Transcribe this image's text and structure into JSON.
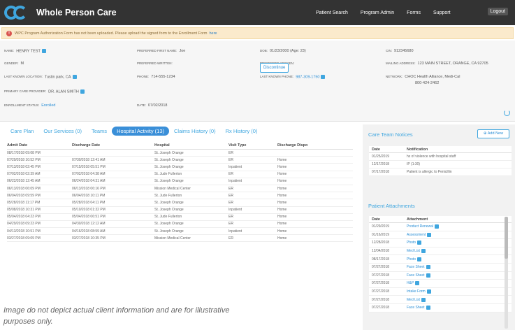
{
  "app": {
    "title": "Whole Person Care"
  },
  "topnav": {
    "items": [
      "Patient Search",
      "Program Admin",
      "Forms",
      "Support"
    ],
    "logout": "Logout"
  },
  "alert": {
    "text": "WPC Program Authorization Form has not been uploaded. Please upload the signed form to the Enrollment Form",
    "link": "here"
  },
  "profile": {
    "name": {
      "label": "NAME:",
      "value": "HENRY TEST"
    },
    "gender": {
      "label": "GENDER:",
      "value": "M"
    },
    "last_location": {
      "label": "LAST KNOWN LOCATION:",
      "value": "Tustin park, CA"
    },
    "pcp": {
      "label": "PRIMARY CARE PROVIDER:",
      "value": "DR. ALAN SMITH"
    },
    "enrollment": {
      "label": "ENROLLMENT STATUS:",
      "value": "Enrolled"
    },
    "preferred_first": {
      "label": "PREFERRED FIRST NAME:",
      "value": "Joe"
    },
    "preferred_written": {
      "label": "PREFERRED WRITTEN:",
      "value": ""
    },
    "phone": {
      "label": "PHONE:",
      "value": "714-555-1234"
    },
    "date": {
      "label": "DATE:",
      "value": "07/02/2018"
    },
    "dob": {
      "label": "DOB:",
      "value": "01/23/2000 (Age: 23)"
    },
    "preferred_spoken": {
      "label": "PREFERRED SPOKEN:",
      "value": ""
    },
    "last_phone": {
      "label": "LAST KNOWN PHONE:",
      "value": "987-309-1750"
    },
    "cin": {
      "label": "CIN:",
      "value": "912345680"
    },
    "mailing": {
      "label": "MAILING ADDRESS:",
      "value": "123 MAIN STREET, ORANGE, CA 92705"
    },
    "network": {
      "label": "NETWORK:",
      "value_line1": "CHOC Health Alliance, Medi-Cal",
      "value_line2": "800-424-2462"
    },
    "discontinue_label": "Discontinue"
  },
  "tabs": [
    "Care Plan",
    "Our Services (0)",
    "Teams",
    "Hospital Activity (13)",
    "Claims History (0)",
    "Rx History (0)"
  ],
  "activity": {
    "headers": [
      "Admit Date",
      "Discharge Date",
      "Hospital",
      "Visit Type",
      "Discharge Dispo"
    ],
    "rows": [
      [
        "08/17/2018 09:08 PM",
        "",
        "St. Joseph Orange",
        "ER",
        ""
      ],
      [
        "07/29/2018 10:52 PM",
        "07/30/2018 12:41 AM",
        "St. Joseph Orange",
        "ER",
        "Home"
      ],
      [
        "07/13/2018 02:45 PM",
        "07/15/2018 05:51 PM",
        "St. Joseph Orange",
        "Inpatient",
        "Home"
      ],
      [
        "07/02/2018 02:39 AM",
        "07/02/2018 04:38 AM",
        "St. Jude Fullerton",
        "ER",
        "Home"
      ],
      [
        "06/22/2018 12:45 AM",
        "06/24/2018 04:31 AM",
        "St. Joseph Orange",
        "Inpatient",
        "Home"
      ],
      [
        "06/13/2018 06:09 PM",
        "06/13/2018 06:16 PM",
        "Mission Medical Center",
        "ER",
        "Home"
      ],
      [
        "06/04/2018 09:59 PM",
        "06/04/2018 10:11 PM",
        "St. Jude Fullerton",
        "ER",
        "Home"
      ],
      [
        "05/28/2018 11:17 PM",
        "05/28/2018 04:11 PM",
        "St. Joseph Orange",
        "ER",
        "Home"
      ],
      [
        "05/08/2018 10:31 PM",
        "05/10/2018 01:32 PM",
        "St. Joseph Orange",
        "Inpatient",
        "Home"
      ],
      [
        "05/04/2018 04:23 PM",
        "05/04/2018 06:51 PM",
        "St. Jude Fullerton",
        "ER",
        "Home"
      ],
      [
        "04/29/2018 09:23 PM",
        "04/30/2018 12:12 AM",
        "St. Joseph Orange",
        "ER",
        "Home"
      ],
      [
        "04/13/2018 10:51 PM",
        "04/16/2018 08:59 AM",
        "St. Joseph Orange",
        "Inpatient",
        "Home"
      ],
      [
        "03/27/2018 09:09 PM",
        "03/27/2018 10:35 PM",
        "Mission Medical Center",
        "ER",
        "Home"
      ]
    ]
  },
  "notices": {
    "title": "Care Team Notices",
    "add_new": "Add New",
    "headers": [
      "Date",
      "Notification"
    ],
    "rows": [
      [
        "01/25/2019",
        "hx of violence with hospital staff"
      ],
      [
        "12/17/2018",
        "IP (1:30)"
      ],
      [
        "07/17/2018",
        "Patient is allergic to Penicillin"
      ]
    ]
  },
  "attachments": {
    "title": "Patient Attachments",
    "headers": [
      "Date",
      "Attachment"
    ],
    "rows": [
      [
        "01/29/2019",
        "Product Renewal"
      ],
      [
        "01/16/2019",
        "Assessment"
      ],
      [
        "12/28/2018",
        "Photo"
      ],
      [
        "12/04/2018",
        "Med List"
      ],
      [
        "08/17/2018",
        "Photo"
      ],
      [
        "07/27/2018",
        "Face Sheet"
      ],
      [
        "07/27/2018",
        "Face Sheet"
      ],
      [
        "07/27/2018",
        "H&P"
      ],
      [
        "07/27/2018",
        "Intake Form"
      ],
      [
        "07/27/2018",
        "Med List"
      ],
      [
        "07/27/2018",
        "Face Sheet"
      ]
    ]
  },
  "disclaimer": "Image do not depict actual client information and are for illustrative purposes only."
}
